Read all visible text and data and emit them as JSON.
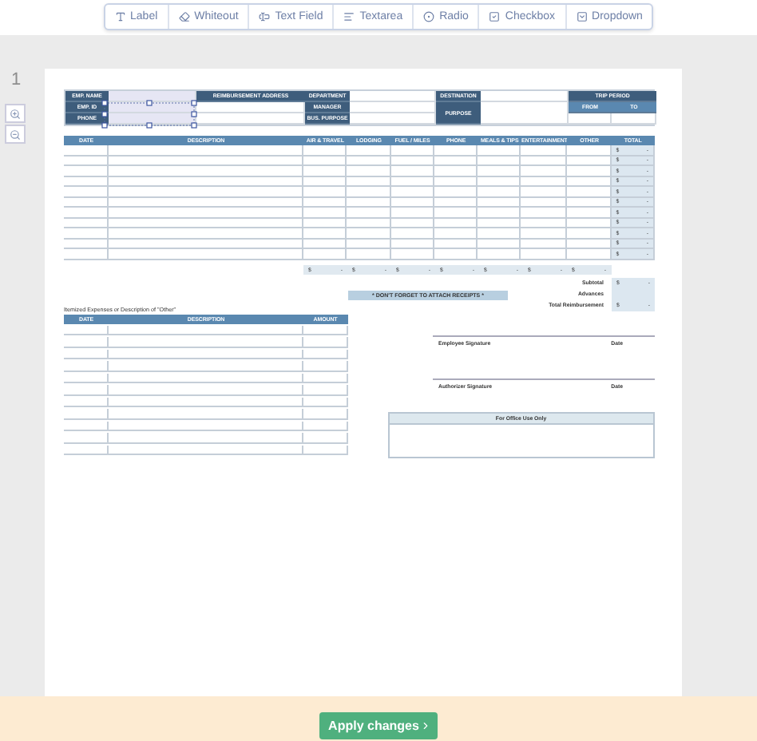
{
  "toolbar": [
    {
      "kind": "label",
      "label": "Label"
    },
    {
      "kind": "whiteout",
      "label": "Whiteout"
    },
    {
      "kind": "textfield",
      "label": "Text Field"
    },
    {
      "kind": "textarea",
      "label": "Textarea"
    },
    {
      "kind": "radio",
      "label": "Radio"
    },
    {
      "kind": "checkbox",
      "label": "Checkbox"
    },
    {
      "kind": "dropdown",
      "label": "Dropdown"
    }
  ],
  "page_number": "1",
  "form": {
    "employee_labels": [
      "EMP. NAME",
      "EMP. ID",
      "PHONE"
    ],
    "reimbursement_address": "REIMBURSEMENT ADDRESS",
    "department_labels": [
      "DEPARTMENT",
      "MANAGER",
      "BUS. PURPOSE"
    ],
    "destination": "DESTINATION",
    "purpose": "PURPOSE",
    "trip_period": {
      "title": "TRIP PERIOD",
      "from": "FROM",
      "to": "TO"
    },
    "expenses": {
      "columns": [
        "DATE",
        "DESCRIPTION",
        "AIR & TRAVEL",
        "LODGING",
        "FUEL / MILES",
        "PHONE",
        "MEALS & TIPS",
        "ENTERTAINMENT",
        "OTHER",
        "TOTAL"
      ],
      "rows": [
        {
          "currency": "$",
          "total": "-"
        },
        {
          "currency": "$",
          "total": "-"
        },
        {
          "currency": "$",
          "total": "-"
        },
        {
          "currency": "$",
          "total": "-"
        },
        {
          "currency": "$",
          "total": "-"
        },
        {
          "currency": "$",
          "total": "-"
        },
        {
          "currency": "$",
          "total": "-"
        },
        {
          "currency": "$",
          "total": "-"
        },
        {
          "currency": "$",
          "total": "-"
        },
        {
          "currency": "$",
          "total": "-"
        },
        {
          "currency": "$",
          "total": "-"
        }
      ],
      "column_totals": [
        {
          "currency": "$",
          "value": "-"
        },
        {
          "currency": "$",
          "value": "-"
        },
        {
          "currency": "$",
          "value": "-"
        },
        {
          "currency": "$",
          "value": "-"
        },
        {
          "currency": "$",
          "value": "-"
        },
        {
          "currency": "$",
          "value": "-"
        },
        {
          "currency": "$",
          "value": "-"
        }
      ]
    },
    "receipts_note": "* DON'T FORGET TO ATTACH RECEIPTS *",
    "summary": [
      {
        "label": "Subtotal",
        "currency": "$",
        "value": "-"
      },
      {
        "label": "Advances"
      },
      {
        "label": "Total Reimbursement",
        "currency": "$",
        "value": "-"
      }
    ],
    "itemized_title": "Itemized Expenses or Description of \"Other\"",
    "itemized": {
      "columns": [
        "DATE",
        "DESCRIPTION",
        "AMOUNT"
      ]
    },
    "signatures": [
      {
        "label": "Employee Signature",
        "date": "Date"
      },
      {
        "label": "Authorizer Signature",
        "date": "Date"
      }
    ],
    "office_use": "For Office Use Only"
  },
  "apply_button": "Apply changes"
}
